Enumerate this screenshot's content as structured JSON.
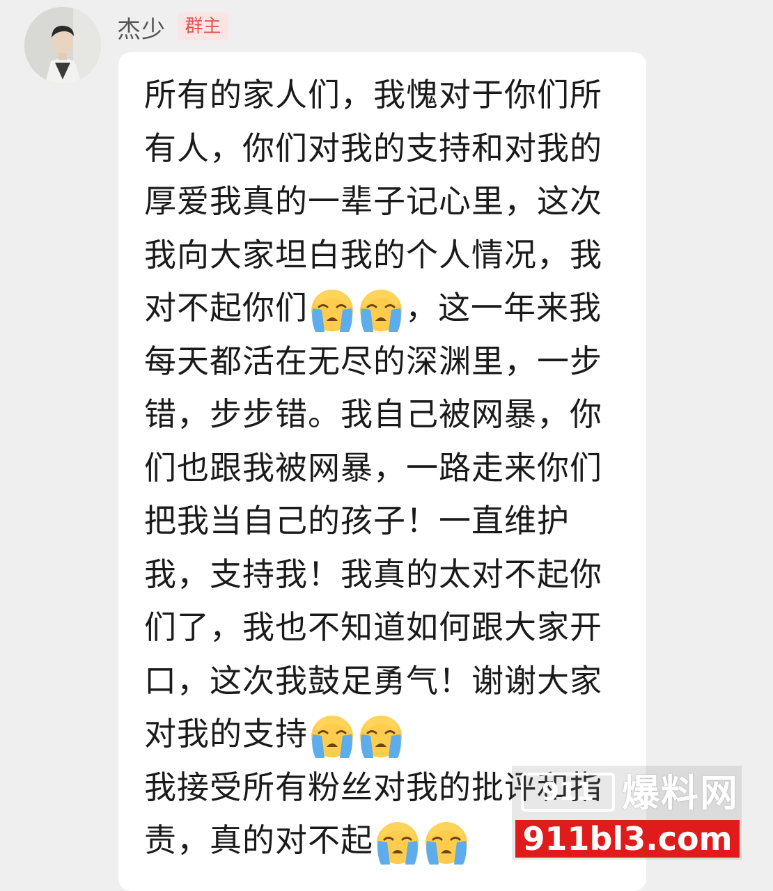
{
  "header": {
    "sender_name": "杰少",
    "role_badge": "群主"
  },
  "message": {
    "lines": [
      [
        "所有的家人们，我愧对于你们所"
      ],
      [
        "有人，你们对我的支持和对我的"
      ],
      [
        "厚爱我真的一辈子记心里，这次"
      ],
      [
        "我向大家坦白我的个人情况，我"
      ],
      [
        "对不起你们",
        "@emoji",
        "@emoji",
        "，这一年来我"
      ],
      [
        "每天都活在无尽的深渊里，一步"
      ],
      [
        "错，步步错。我自己被网暴，你"
      ],
      [
        "们也跟我被网暴，一路走来你们"
      ],
      [
        "把我当自己的孩子！一直维护"
      ],
      [
        "我，支持我！我真的太对不起你"
      ],
      [
        "们了，我也不知道如何跟大家开"
      ],
      [
        "口，这次我鼓足勇气！谢谢大家"
      ],
      [
        "对我的支持",
        "@emoji",
        "@emoji"
      ],
      [
        "我接受所有粉丝对我的批评和指"
      ],
      [
        "责，真的对不起",
        "@emoji",
        "@emoji"
      ]
    ],
    "emoji_icon": "loudly-crying-face-icon"
  },
  "watermark": {
    "logo": "911",
    "title": "爆料网",
    "url": "911bl3.com"
  },
  "colors": {
    "background": "#efefef",
    "bubble": "#ffffff",
    "text": "#1a1a1a",
    "badge_bg": "#fbe4e4",
    "badge_text": "#e05555",
    "watermark_red": "#e01b1b"
  }
}
